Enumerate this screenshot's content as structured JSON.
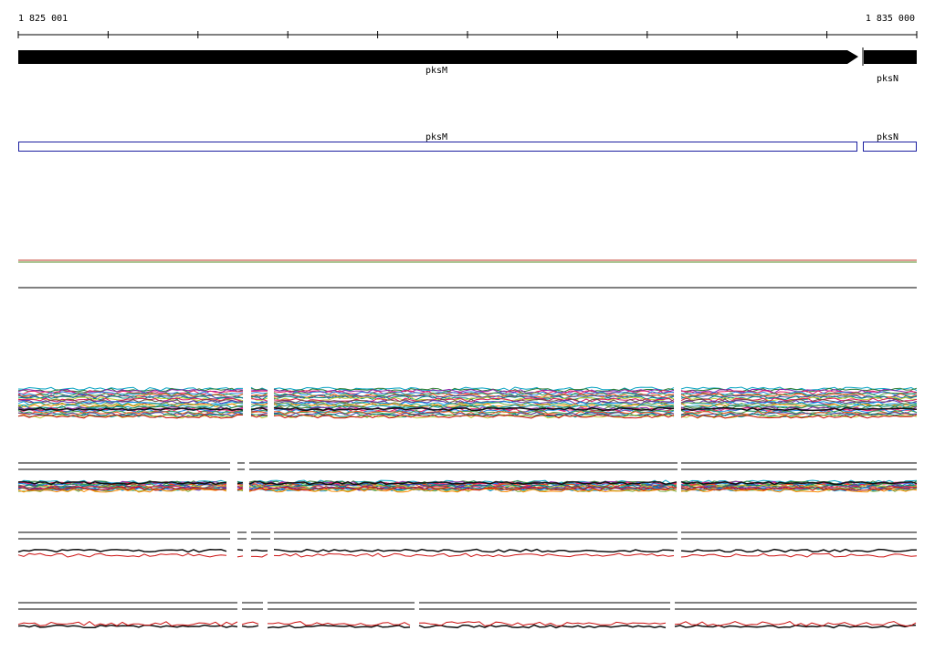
{
  "coordinates": {
    "start_label": "1 825 001",
    "end_label": "1 835 000"
  },
  "genes": [
    {
      "name": "pksM"
    },
    {
      "name": "pksN"
    }
  ],
  "annotation_boxes": [
    {
      "name": "pksM"
    },
    {
      "name": "pksN"
    }
  ],
  "colors": {
    "gene_arrow": "#000000",
    "annotation_box": "#1b1fa0",
    "baseline_red": "#c0392b",
    "baseline_green": "#5a8f2e",
    "series_palette": [
      "#00a0c0",
      "#2e7d32",
      "#8e24aa",
      "#e91e63",
      "#1e88e5",
      "#43a047",
      "#f4511e",
      "#3949ab",
      "#00897b",
      "#c0ca33",
      "#d81b60",
      "#6d4c41",
      "#5e35b1",
      "#039be5",
      "#7cb342",
      "#fb8c00"
    ],
    "coverage_dark": "#111111",
    "coverage_red": "#cc1111"
  }
}
